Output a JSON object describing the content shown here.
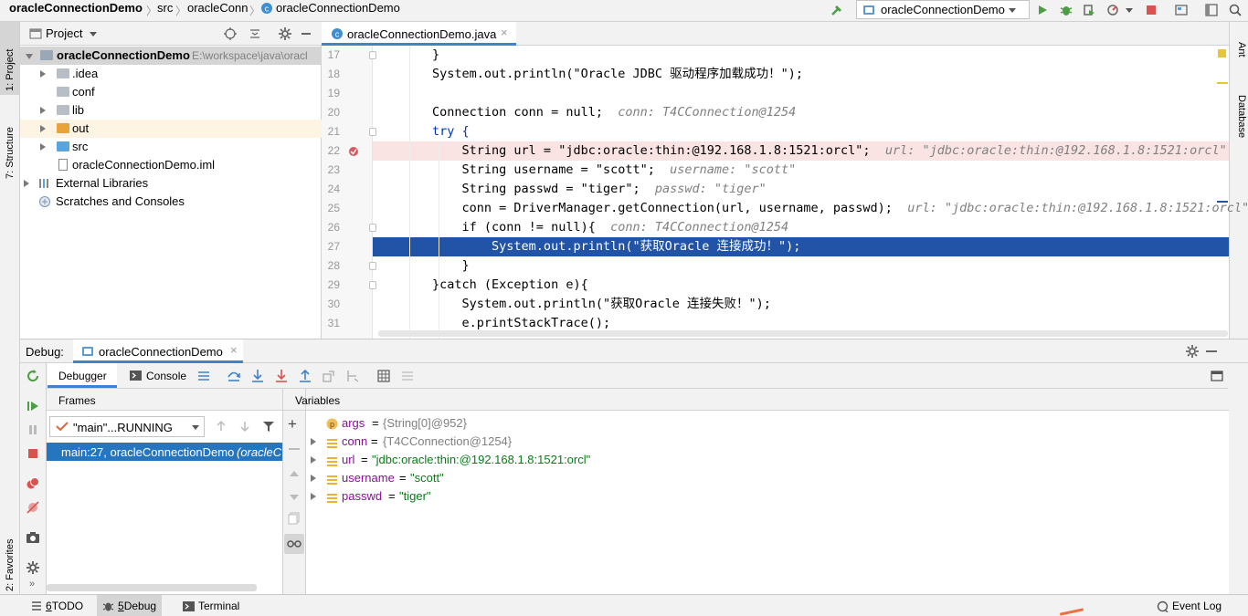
{
  "breadcrumb": {
    "project": "oracleConnectionDemo",
    "src": "src",
    "pkg": "oracleConn",
    "file": "oracleConnectionDemo"
  },
  "run_config": {
    "selected": "oracleConnectionDemo"
  },
  "left_strip": {
    "project_tab": "1: Project",
    "structure_tab": "7: Structure",
    "favorites_tab": "2: Favorites"
  },
  "right_strip": {
    "ant_tab": "Ant",
    "database_tab": "Database"
  },
  "project_panel": {
    "title": "Project",
    "tree": [
      {
        "label": "oracleConnectionDemo",
        "extra": "E:\\workspace\\java\\oracl",
        "type": "module"
      },
      {
        "label": ".idea",
        "type": "folder"
      },
      {
        "label": "conf",
        "type": "folder"
      },
      {
        "label": "lib",
        "type": "folder"
      },
      {
        "label": "out",
        "type": "folder-orange"
      },
      {
        "label": "src",
        "type": "folder-blue"
      },
      {
        "label": "oracleConnectionDemo.iml",
        "type": "file"
      },
      {
        "label": "External Libraries",
        "type": "lib"
      },
      {
        "label": "Scratches and Consoles",
        "type": "scratch"
      }
    ]
  },
  "editor": {
    "tab_label": "oracleConnectionDemo.java",
    "lines": [
      {
        "n": "17",
        "text": "        }",
        "hint": ""
      },
      {
        "n": "18",
        "text": "        System.out.println(\"Oracle JDBC 驱动程序加载成功！\");",
        "hint": ""
      },
      {
        "n": "19",
        "text": "",
        "hint": ""
      },
      {
        "n": "20",
        "text": "        Connection conn = null;",
        "hint": "conn: T4CConnection@1254"
      },
      {
        "n": "21",
        "text": "        try {",
        "hint": ""
      },
      {
        "n": "22",
        "text": "            String url = \"jdbc:oracle:thin:@192.168.1.8:1521:orcl\";",
        "hint": "url: \"jdbc:oracle:thin:@192.168.1.8:1521:orcl\""
      },
      {
        "n": "23",
        "text": "            String username = \"scott\";",
        "hint": "username: \"scott\""
      },
      {
        "n": "24",
        "text": "            String passwd = \"tiger\";",
        "hint": "passwd: \"tiger\""
      },
      {
        "n": "25",
        "text": "            conn = DriverManager.getConnection(url, username, passwd);",
        "hint": "url: \"jdbc:oracle:thin:@192.168.1.8:1521:orcl\""
      },
      {
        "n": "26",
        "text": "            if (conn != null){",
        "hint": "conn: T4CConnection@1254"
      },
      {
        "n": "27",
        "text": "                System.out.println(\"获取Oracle 连接成功！\");",
        "hint": ""
      },
      {
        "n": "28",
        "text": "            }",
        "hint": ""
      },
      {
        "n": "29",
        "text": "        }catch (Exception e){",
        "hint": ""
      },
      {
        "n": "30",
        "text": "            System.out.println(\"获取Oracle 连接失败！\");",
        "hint": ""
      },
      {
        "n": "31",
        "text": "            e.printStackTrace();",
        "hint": ""
      }
    ]
  },
  "debug": {
    "title": "Debug:",
    "session_tab": "oracleConnectionDemo",
    "debugger_tab": "Debugger",
    "console_tab": "Console",
    "frames_label": "Frames",
    "variables_label": "Variables",
    "thread_select": "\"main\"...RUNNING",
    "frame_selected": "main:27, oracleConnectionDemo",
    "frame_selected_pkg": "(oracleC",
    "variables": [
      {
        "icon": "p",
        "name": "args",
        "value": "{String[0]@952}",
        "kind": "obj"
      },
      {
        "icon": "list",
        "name": "conn",
        "value": "{T4CConnection@1254}",
        "kind": "obj"
      },
      {
        "icon": "list",
        "name": "url",
        "value": "\"jdbc:oracle:thin:@192.168.1.8:1521:orcl\"",
        "kind": "str"
      },
      {
        "icon": "list",
        "name": "username",
        "value": "\"scott\"",
        "kind": "str"
      },
      {
        "icon": "list",
        "name": "passwd",
        "value": "\"tiger\"",
        "kind": "str"
      }
    ],
    "equals": "="
  },
  "statusbar": {
    "todo_num": "6",
    "todo_label": "TODO",
    "debug_num": "5",
    "debug_label": "Debug",
    "terminal_label": "Terminal",
    "event_log": "Event Log"
  },
  "colors": {
    "selection": "#2154a6",
    "breakpoint_line": "#fae3e3",
    "current_line": "#2154a6",
    "frame_selected": "#2675bf"
  }
}
